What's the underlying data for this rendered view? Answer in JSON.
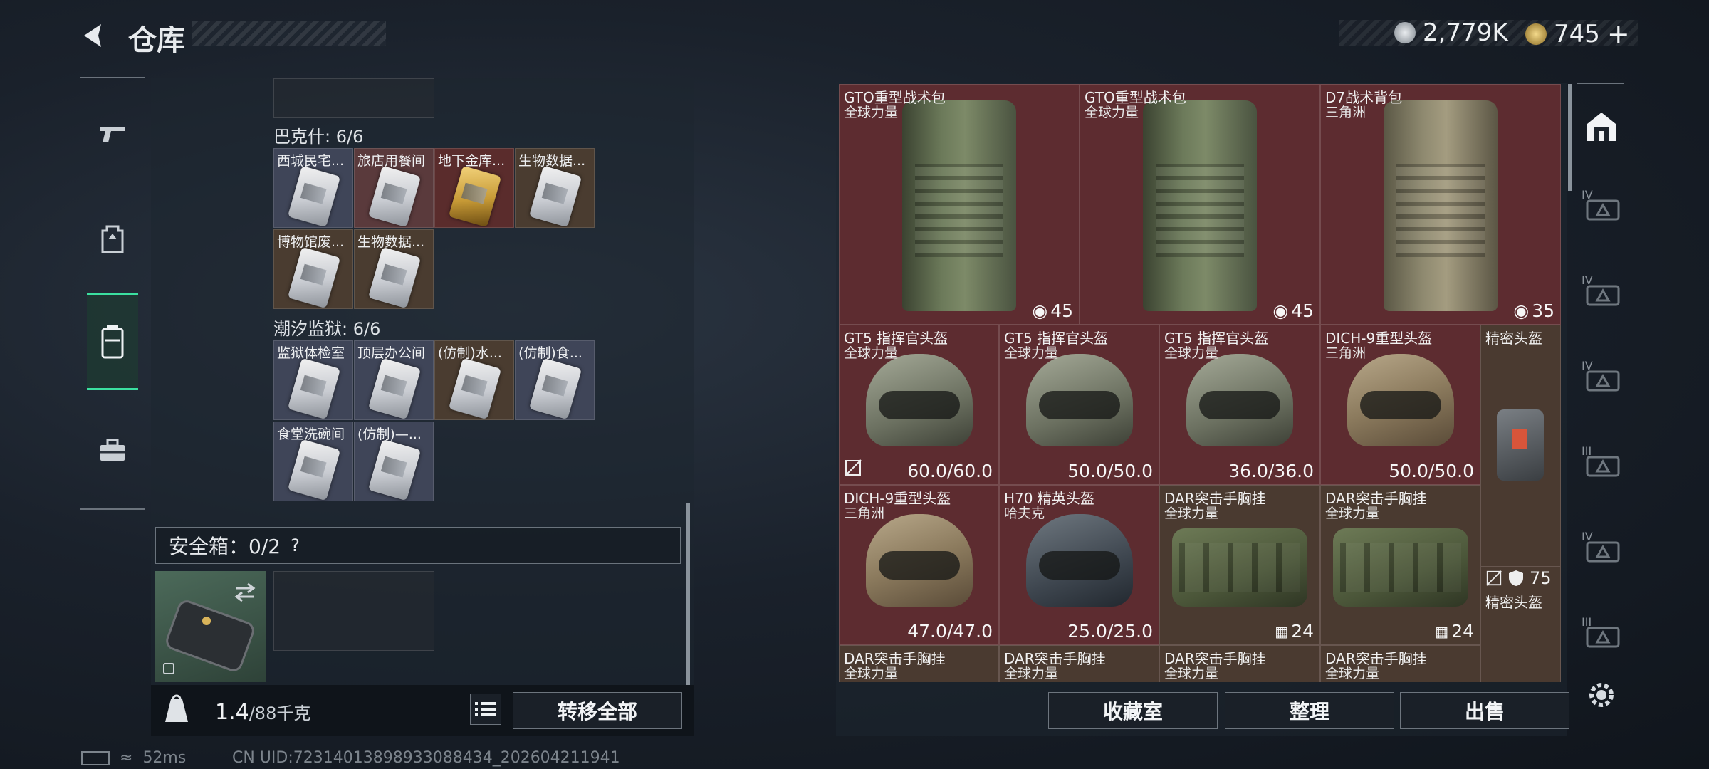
{
  "header": {
    "title": "仓库"
  },
  "currency": {
    "silver_value": "2,779K",
    "gold_value": "745",
    "gold_plus": "+",
    "silver_color": "#c7ccd2",
    "gold_color": "#d9b45a"
  },
  "rail": [
    {
      "icon": "pistol-icon"
    },
    {
      "icon": "backpack-icon"
    },
    {
      "icon": "storage-box-icon",
      "active": true
    },
    {
      "icon": "toolbox-icon"
    }
  ],
  "left": {
    "groups": [
      {
        "label": "巴克什: 6/6",
        "items": [
          "西城民宅...",
          "旅店用餐间",
          "地下金库...",
          "生物数据...",
          "博物馆废...",
          "生物数据..."
        ]
      },
      {
        "label": "潮汐监狱: 6/6",
        "items": [
          "监狱体检室",
          "顶层办公间",
          "(仿制)水...",
          "(仿制)食...",
          "食堂洗碗间",
          "(仿制)—..."
        ]
      }
    ],
    "safebox": {
      "label": "安全箱：0/2",
      "help": "?"
    },
    "weight": {
      "current": "1.4",
      "max": "/88千克"
    },
    "transfer_all": "转移全部"
  },
  "grid": {
    "backpacks": [
      {
        "name": "GTO重型战术包",
        "faction": "全球力量",
        "value": "45"
      },
      {
        "name": "GTO重型战术包",
        "faction": "全球力量",
        "value": "45"
      },
      {
        "name": "D7战术背包",
        "faction": "三角洲",
        "value": "35"
      }
    ],
    "helmets_row": [
      {
        "name": "GT5 指挥官头盔",
        "faction": "全球力量",
        "value": "60.0/60.0"
      },
      {
        "name": "GT5 指挥官头盔",
        "faction": "全球力量",
        "value": "50.0/50.0"
      },
      {
        "name": "GT5 指挥官头盔",
        "faction": "全球力量",
        "value": "36.0/36.0"
      },
      {
        "name": "DICH-9重型头盔",
        "faction": "三角洲",
        "value": "50.0/50.0"
      },
      {
        "name": "精密头盔"
      }
    ],
    "row3": [
      {
        "name": "DICH-9重型头盔",
        "faction": "三角洲",
        "value": "47.0/47.0"
      },
      {
        "name": "H70 精英头盔",
        "faction": "哈夫克",
        "value": "25.0/25.0"
      },
      {
        "name": "DAR突击手胸挂",
        "faction": "全球力量",
        "value": "24"
      },
      {
        "name": "DAR突击手胸挂",
        "faction": "全球力量",
        "value": "24"
      },
      {
        "name": "精密头盔",
        "value": "75"
      }
    ],
    "row4": [
      {
        "name": "DAR突击手胸挂",
        "faction": "全球力量"
      },
      {
        "name": "DAR突击手胸挂",
        "faction": "全球力量"
      },
      {
        "name": "DAR突击手胸挂",
        "faction": "全球力量"
      },
      {
        "name": "DAR突击手胸挂",
        "faction": "全球力量"
      }
    ]
  },
  "bottom_buttons": {
    "collection": "收藏室",
    "sort": "整理",
    "sell": "出售"
  },
  "right_rail": {
    "tiers": [
      "IV",
      "IV",
      "IV",
      "III",
      "IV",
      "III"
    ]
  },
  "status": {
    "ping": "52ms",
    "uid": "CN UID:72314013898933088434_202604211941"
  }
}
